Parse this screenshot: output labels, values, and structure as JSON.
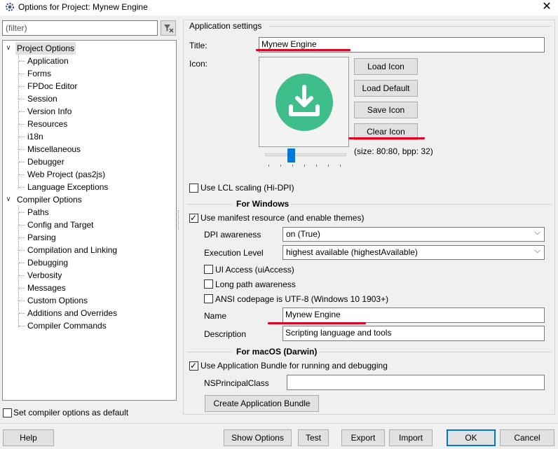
{
  "window": {
    "title": "Options for Project: Mynew Engine",
    "close_glyph": "✕"
  },
  "filter": {
    "value": "(filter)"
  },
  "tree": {
    "root1": "Project Options",
    "project_items": [
      "Application",
      "Forms",
      "FPDoc Editor",
      "Session",
      "Version Info",
      "Resources",
      "i18n",
      "Miscellaneous",
      "Debugger",
      "Web Project (pas2js)",
      "Language Exceptions"
    ],
    "root2": "Compiler Options",
    "compiler_items": [
      "Paths",
      "Config and Target",
      "Parsing",
      "Compilation and Linking",
      "Debugging",
      "Verbosity",
      "Messages",
      "Custom Options",
      "Additions and Overrides",
      "Compiler Commands"
    ],
    "toggle_glyph": "∨"
  },
  "set_default": {
    "label": "Set compiler options as default",
    "checked": false
  },
  "app_settings": {
    "group_title": "Application settings",
    "title_label": "Title:",
    "title_value": "Mynew Engine",
    "icon_label": "Icon:",
    "load_icon": "Load Icon",
    "load_default": "Load Default",
    "save_icon": "Save Icon",
    "clear_icon": "Clear Icon",
    "icon_info": "(size: 80:80, bpp: 32)",
    "icon_color": "#3dbe8a",
    "icon_name": "download-icon",
    "scale_slider_fraction": 0.3,
    "use_lcl_scaling": "Use LCL scaling (Hi-DPI)",
    "use_lcl_scaling_checked": false
  },
  "windows": {
    "group_title": "For Windows",
    "use_manifest": "Use manifest resource (and enable themes)",
    "use_manifest_checked": true,
    "dpi_label": "DPI awareness",
    "dpi_value": "on (True)",
    "exec_label": "Execution Level",
    "exec_value": "highest available (highestAvailable)",
    "ui_access": "UI Access (uiAccess)",
    "long_path": "Long path awareness",
    "ansi_codepage": "ANSI codepage is UTF-8 (Windows 10 1903+)",
    "name_label": "Name",
    "name_value": "Mynew Engine",
    "desc_label": "Description",
    "desc_value": "Scripting language and tools"
  },
  "macos": {
    "group_title": "For macOS (Darwin)",
    "use_bundle": "Use Application Bundle for running and debugging",
    "use_bundle_checked": true,
    "ns_label": "NSPrincipalClass",
    "ns_value": "",
    "create_bundle": "Create Application Bundle"
  },
  "buttons": {
    "help": "Help",
    "show_options": "Show Options",
    "test": "Test",
    "export": "Export",
    "import": "Import",
    "ok": "OK",
    "cancel": "Cancel"
  },
  "colors": {
    "annotation_red": "#e6001e",
    "accent_blue": "#0078d7"
  }
}
